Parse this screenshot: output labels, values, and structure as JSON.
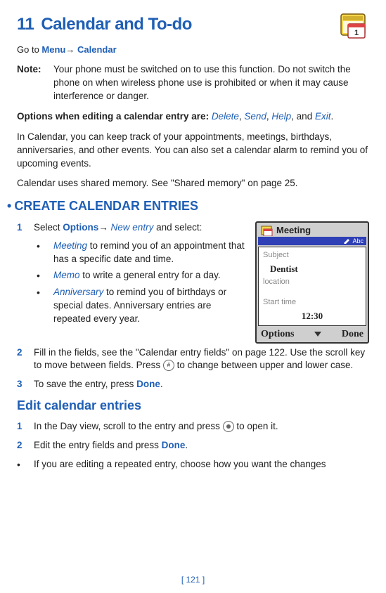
{
  "chapter": {
    "number": "11",
    "title": "Calendar and To-do"
  },
  "goto": {
    "prefix": "Go to ",
    "menu": "Menu",
    "arrow": "→ ",
    "target": "Calendar"
  },
  "note": {
    "label": "Note:",
    "text": "Your phone must be switched on to use this function. Do not switch the phone on when wireless phone use is prohibited or when it may cause interference or danger."
  },
  "options_line": {
    "prefix": "Options when editing a calendar entry are: ",
    "o1": "Delete",
    "s1": ", ",
    "o2": "Send",
    "s2": ", ",
    "o3": "Help",
    "s3": ", and ",
    "o4": "Exit",
    "end": "."
  },
  "para1": "In Calendar, you can keep track of your appointments, meetings, birthdays, anniversaries, and other events. You can also set a calendar alarm to remind you of upcoming events.",
  "para2": "Calendar uses shared memory. See \"Shared memory\" on page 25.",
  "section1_title": "CREATE CALENDAR ENTRIES",
  "step1": {
    "num": "1",
    "p1": "Select ",
    "opt": "Options",
    "arrow": "→ ",
    "ne": "New entry",
    "p2": " and select:"
  },
  "sub": {
    "meeting_term": "Meeting",
    "meeting_desc": " to remind you of an appointment that has a specific date and time.",
    "memo_term": "Memo",
    "memo_desc": " to write a general entry for a day.",
    "anniv_term": "Anniversary",
    "anniv_desc": " to remind you of birthdays or special dates. Anniversary entries are repeated every year."
  },
  "step2": {
    "num": "2",
    "p1": "Fill in the fields, see the \"Calendar entry fields\" on page 122. Use the scroll key to move between fields. Press ",
    "p2": " to change between upper and lower case."
  },
  "step3": {
    "num": "3",
    "p1": "To save the entry, press ",
    "done": "Done",
    "p2": "."
  },
  "subsection": "Edit calendar entries",
  "edit_step1": {
    "num": "1",
    "p1": "In the Day view, scroll to the entry and press ",
    "p2": " to open it."
  },
  "edit_step2": {
    "num": "2",
    "p1": "Edit the entry fields and press ",
    "done": "Done",
    "p2": "."
  },
  "edit_bullet": "If you are editing a repeated entry, choose how you want the changes",
  "page_footer": "[ 121 ]",
  "phone": {
    "title": "Meeting",
    "indicator": "Abc",
    "label_subject": "Subject",
    "value_subject": "Dentist",
    "label_location": "location",
    "label_start": "Start time",
    "value_start": "12:30",
    "soft_left": "Options",
    "soft_right": "Done"
  }
}
